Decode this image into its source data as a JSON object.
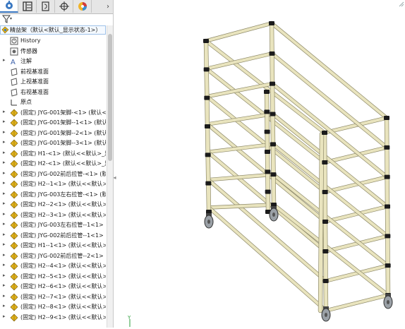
{
  "panel": {
    "tabs": [
      {
        "name": "feature-manager-tab-icon",
        "active": true
      },
      {
        "name": "property-manager-tab-icon",
        "active": false
      },
      {
        "name": "configuration-manager-tab-icon",
        "active": false
      },
      {
        "name": "dimxpert-manager-tab-icon",
        "active": false
      },
      {
        "name": "display-manager-tab-icon",
        "active": false
      }
    ],
    "expand_glyph": "›",
    "root_label": "精益架（默认<默认_显示状态-1>）",
    "items": [
      {
        "label": "History",
        "icon": "history-icon",
        "arrow": false
      },
      {
        "label": "传感器",
        "icon": "sensor-icon",
        "arrow": false
      },
      {
        "label": "注解",
        "icon": "annotation-icon",
        "arrow": true
      },
      {
        "label": "前视基准面",
        "icon": "plane-icon",
        "arrow": false
      },
      {
        "label": "上视基准面",
        "icon": "plane-icon",
        "arrow": false
      },
      {
        "label": "右视基准面",
        "icon": "plane-icon",
        "arrow": false
      },
      {
        "label": "原点",
        "icon": "origin-icon",
        "arrow": false
      },
      {
        "label": "(固定) JYG-001架脚-<1> (默认<<",
        "icon": "part-icon",
        "arrow": true
      },
      {
        "label": "(固定) JYG-001架脚--1<1> (默认<",
        "icon": "part-icon",
        "arrow": true
      },
      {
        "label": "(固定) JYG-001架脚--2<1> (默认<",
        "icon": "part-icon",
        "arrow": true
      },
      {
        "label": "(固定) JYG-001架脚--3<1> (默认<",
        "icon": "part-icon",
        "arrow": true
      },
      {
        "label": "(固定) H1-<1> (默认<<默认>_显",
        "icon": "part-icon",
        "arrow": true
      },
      {
        "label": "(固定) H2-<1> (默认<<默认>_显",
        "icon": "part-icon",
        "arrow": true
      },
      {
        "label": "(固定) JYG-002前后拉管-<1> (默",
        "icon": "part-icon",
        "arrow": true
      },
      {
        "label": "(固定) H2--1<1> (默认<<默认>_",
        "icon": "part-icon",
        "arrow": true
      },
      {
        "label": "(固定) JYG-003左右拉管-<1> (默",
        "icon": "part-icon",
        "arrow": true
      },
      {
        "label": "(固定) H2--2<1> (默认<<默认>_",
        "icon": "part-icon",
        "arrow": true
      },
      {
        "label": "(固定) H2--3<1> (默认<<默认>_",
        "icon": "part-icon",
        "arrow": true
      },
      {
        "label": "(固定) JYG-003左右拉管--1<1>",
        "icon": "part-icon",
        "arrow": true
      },
      {
        "label": "(固定) JYG-002前后拉管--1<1>",
        "icon": "part-icon",
        "arrow": true
      },
      {
        "label": "(固定) H1--1<1> (默认<<默认>_",
        "icon": "part-icon",
        "arrow": true
      },
      {
        "label": "(固定) JYG-002前后拉管--2<1>",
        "icon": "part-icon",
        "arrow": true
      },
      {
        "label": "(固定) H2--4<1> (默认<<默认>_",
        "icon": "part-icon",
        "arrow": true
      },
      {
        "label": "(固定) H2--5<1> (默认<<默认>_",
        "icon": "part-icon",
        "arrow": true
      },
      {
        "label": "(固定) H2--6<1> (默认<<默认>_",
        "icon": "part-icon",
        "arrow": true
      },
      {
        "label": "(固定) H2--7<1> (默认<<默认>_",
        "icon": "part-icon",
        "arrow": true
      },
      {
        "label": "(固定) H2--8<1> (默认<<默认>_",
        "icon": "part-icon",
        "arrow": true
      },
      {
        "label": "(固定) H2--9<1> (默认<<默认>_",
        "icon": "part-icon",
        "arrow": true
      }
    ]
  },
  "viewport": {
    "triad_label": "Y",
    "colors": {
      "tube": "#e9e4be",
      "tube_edge": "#8e8a6a",
      "joint": "#1b1b1b",
      "wheel": "#9aa0a6"
    }
  },
  "colors": {
    "tab_active_accent": "#3a78c2",
    "part_icon": "#e0b21c",
    "selection_border": "#9ec1e8"
  }
}
